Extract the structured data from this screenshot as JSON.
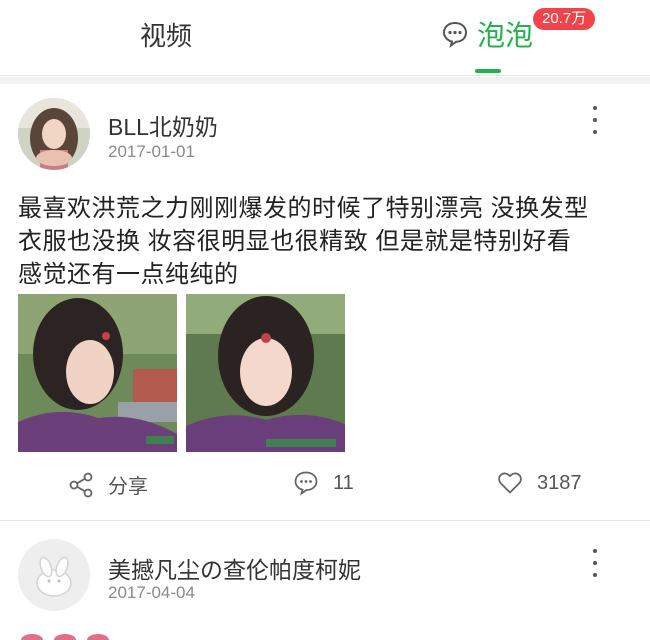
{
  "tabs": {
    "video_label": "视频",
    "bubble_label": "泡泡",
    "bubble_badge": "20.7万",
    "active_color": "#22b14c"
  },
  "posts": [
    {
      "username": "BLL北奶奶",
      "date": "2017-01-01",
      "content_lines": [
        "最喜欢洪荒之力刚刚爆发的时候了特别漂亮  没换发型",
        "衣服也没换   妆容很明显也很精致   但是就是特别好看",
        "感觉还有一点纯纯的"
      ],
      "share_label": "分享",
      "comment_count": "11",
      "like_count": "3187"
    },
    {
      "username": "美撼凡尘の查伦帕度柯妮",
      "date": "2017-04-04"
    }
  ]
}
